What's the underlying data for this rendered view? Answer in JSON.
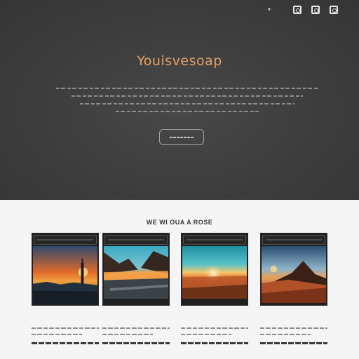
{
  "header": {
    "brand": "",
    "icons": [
      "chevron-down-icon",
      "camera-icon",
      "image-icon",
      "document-icon"
    ]
  },
  "hero": {
    "title": "Youisvesoap",
    "subtitle": "",
    "button_label": ""
  },
  "gallery": {
    "title": "WE WI OUA A ROSE",
    "cards": [
      {
        "title": "",
        "scene": "coastal city sunset with tall tower"
      },
      {
        "title": "",
        "scene": "mountain lake at sunset"
      },
      {
        "title": "",
        "scene": "sun over teal sea horizon"
      },
      {
        "title": "",
        "scene": "desert dunes and mountain at dusk"
      }
    ]
  },
  "colors": {
    "hero_bg": "#3d3d3d",
    "title_accent": "#e9a066",
    "page_bg": "#f5f5f5"
  }
}
